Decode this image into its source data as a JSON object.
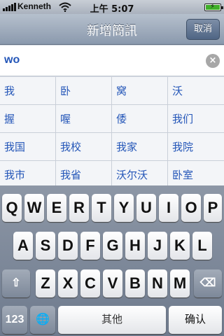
{
  "status": {
    "carrier": "Kenneth",
    "time": "上午 5:07"
  },
  "nav": {
    "title": "新增簡訊",
    "cancel_label": "取消"
  },
  "search": {
    "value": "wo",
    "clear_glyph": "×"
  },
  "candidates": [
    [
      "我",
      "卧",
      "窝",
      "沃"
    ],
    [
      "握",
      "喔",
      "倭",
      "我们"
    ],
    [
      "我国",
      "我校",
      "我家",
      "我院"
    ],
    [
      "我市",
      "我省",
      "沃尔沃",
      "卧室"
    ]
  ],
  "keyboard": {
    "row1": [
      "Q",
      "W",
      "E",
      "R",
      "T",
      "Y",
      "U",
      "I",
      "O",
      "P"
    ],
    "row2": [
      "A",
      "S",
      "D",
      "F",
      "G",
      "H",
      "J",
      "K",
      "L"
    ],
    "row3": [
      "Z",
      "X",
      "C",
      "V",
      "B",
      "N",
      "M"
    ],
    "shift_glyph": "⇧",
    "delete_glyph": "⌫",
    "numbers_label": "123",
    "globe_glyph": "🌐",
    "space_label": "其他",
    "confirm_label": "确认"
  }
}
